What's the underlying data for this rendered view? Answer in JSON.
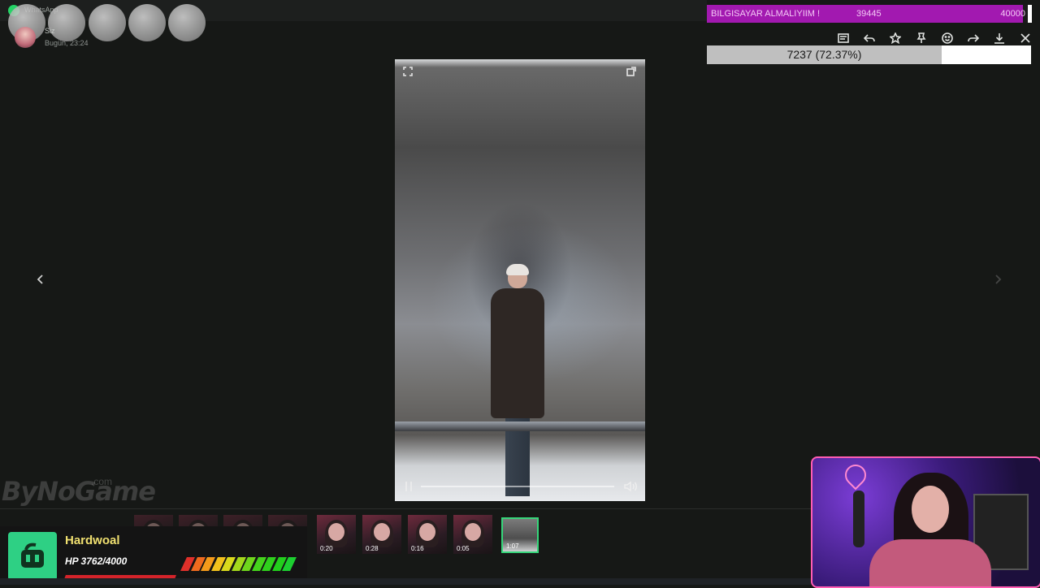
{
  "whatsapp": {
    "app_name": "WhatsApp",
    "sender": "Siz",
    "timestamp": "Bugün, 23:24"
  },
  "goal": {
    "title": "BILGISAYAR ALMALIYIIM !",
    "current": "39445",
    "target": "40000",
    "fraction": 0.986,
    "color": "#a219b0"
  },
  "toolbar": {
    "icons": [
      "caption-icon",
      "reply-icon",
      "star-icon",
      "pin-icon",
      "emoji-icon",
      "forward-icon",
      "download-icon",
      "close-icon"
    ]
  },
  "progress": {
    "label": "7237 (72.37%)",
    "fraction": 0.7237
  },
  "thumbnails": [
    {
      "duration": "0:20"
    },
    {
      "duration": "0:28"
    },
    {
      "duration": "0:16"
    },
    {
      "duration": "0:05"
    },
    {
      "duration": "1:07",
      "selected": true
    }
  ],
  "watermark": {
    "brand": "ByNoGame",
    "suffix": ".com"
  },
  "hp": {
    "name": "Hardwoal",
    "value": "HP 3762/4000",
    "colors": [
      "#e0302a",
      "#ef6a1e",
      "#f49a1a",
      "#f2c11c",
      "#d9d91c",
      "#a4d81c",
      "#6fd61c",
      "#45d41c",
      "#2fd11c",
      "#22cf1c",
      "#1ccf30"
    ]
  },
  "colors": {
    "accent_green": "#36d67a",
    "webcam_border": "#ff5db3"
  }
}
